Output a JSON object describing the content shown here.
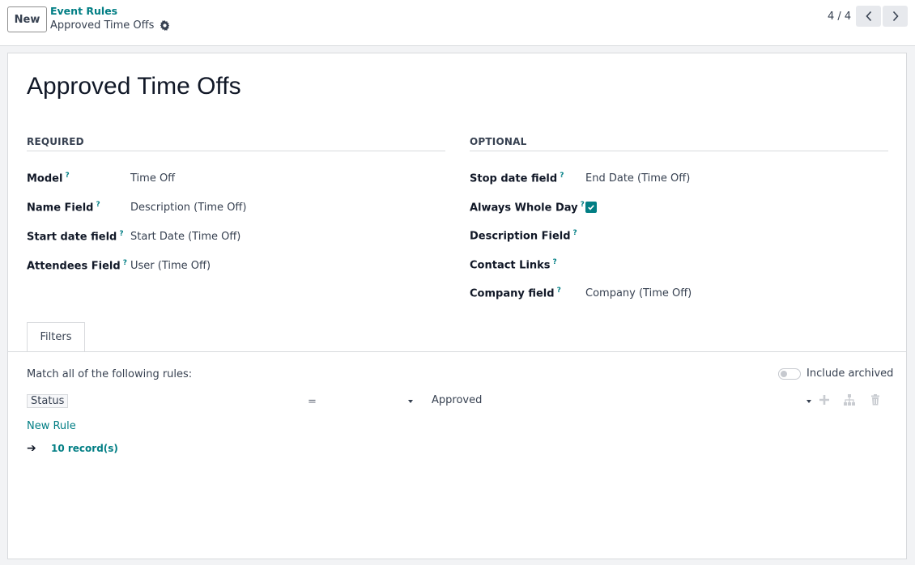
{
  "control_panel": {
    "new_label": "New",
    "breadcrumb_parent": "Event Rules",
    "breadcrumb_current": "Approved Time Offs",
    "pager_value": "4 / 4"
  },
  "record": {
    "title": "Approved Time Offs"
  },
  "required": {
    "group_title": "REQUIRED",
    "fields": [
      {
        "label": "Model",
        "value": "Time Off"
      },
      {
        "label": "Name Field",
        "value": "Description (Time Off)"
      },
      {
        "label": "Start date field",
        "value": "Start Date (Time Off)"
      },
      {
        "label": "Attendees Field",
        "value": "User (Time Off)"
      }
    ]
  },
  "optional": {
    "group_title": "OPTIONAL",
    "fields": [
      {
        "label": "Stop date field",
        "value": "End Date (Time Off)"
      },
      {
        "label": "Always Whole Day",
        "checked": true
      },
      {
        "label": "Description Field",
        "value": ""
      },
      {
        "label": "Contact Links",
        "value": ""
      },
      {
        "label": "Company field",
        "value": "Company (Time Off)"
      }
    ]
  },
  "tooltip_marker": "?",
  "tabs": [
    {
      "label": "Filters",
      "active": true
    }
  ],
  "filters": {
    "match_text": "Match all of the following rules:",
    "include_archived_label": "Include archived",
    "include_archived": false,
    "rule": {
      "field": "Status",
      "operator": "=",
      "value": "Approved"
    },
    "new_rule_label": "New Rule",
    "arrow": "➔",
    "records_label": "10 record(s)"
  },
  "colors": {
    "accent": "#017e84",
    "text": "#374151",
    "border": "#d8dadd"
  }
}
